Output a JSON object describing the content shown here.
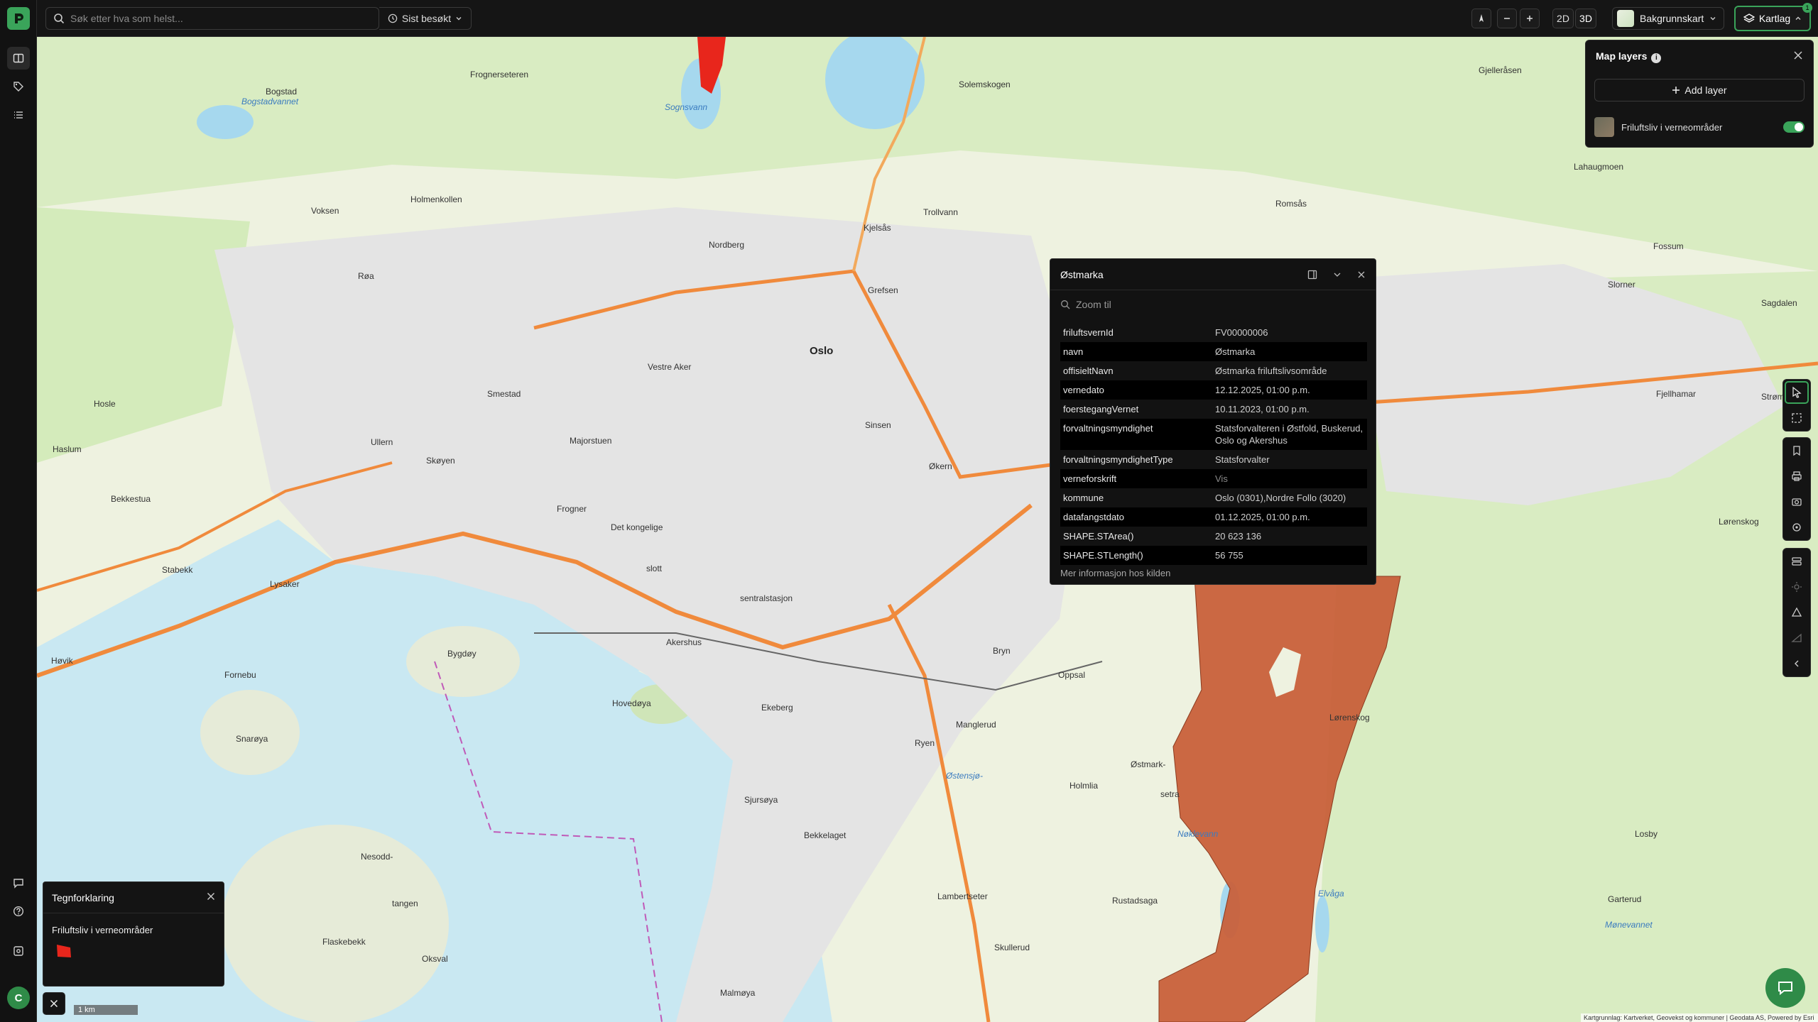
{
  "topbar": {
    "search_placeholder": "Søk etter hva som helst...",
    "recent_label": "Sist besøkt",
    "mode_2d": "2D",
    "mode_3d": "3D",
    "basemap_label": "Bakgrunnskart",
    "layers_label": "Kartlag",
    "layers_count": "1"
  },
  "layers_panel": {
    "title": "Map layers",
    "add_label": "Add layer",
    "layers": [
      {
        "name": "Friluftsliv i verneområder",
        "enabled": true
      }
    ]
  },
  "popup": {
    "title": "Østmarka",
    "zoom_label": "Zoom til",
    "rows": [
      {
        "key": "friluftsvernId",
        "value": "FV00000006"
      },
      {
        "key": "navn",
        "value": "Østmarka"
      },
      {
        "key": "offisieltNavn",
        "value": "Østmarka friluftslivsområde"
      },
      {
        "key": "vernedato",
        "value": "12.12.2025, 01:00 p.m."
      },
      {
        "key": "foerstegangVernet",
        "value": "10.11.2023, 01:00 p.m."
      },
      {
        "key": "forvaltningsmyndighet",
        "value": "Statsforvalteren i Østfold, Buskerud, Oslo og Akershus"
      },
      {
        "key": "forvaltningsmyndighetType",
        "value": "Statsforvalter"
      },
      {
        "key": "verneforskrift",
        "value": "Vis"
      },
      {
        "key": "kommune",
        "value": "Oslo (0301),Nordre Follo (3020)"
      },
      {
        "key": "datafangstdato",
        "value": "01.12.2025, 01:00 p.m."
      },
      {
        "key": "SHAPE.STArea()",
        "value": "20 623 136"
      },
      {
        "key": "SHAPE.STLength()",
        "value": "56 755"
      }
    ],
    "more_label": "Mer informasjon hos kilden"
  },
  "legend": {
    "title": "Tegnforklaring",
    "layer_name": "Friluftsliv i verneområder",
    "swatch_color": "#e8261c"
  },
  "map": {
    "scale_label": "1 km",
    "attribution": "Kartgrunnlag: Kartverket, Geovekst og kommuner | Geodata AS, Powered by Esri",
    "area_color": "#c8603a",
    "places": [
      {
        "text": "Oslo",
        "big": true
      },
      {
        "text": "Vestre Aker"
      },
      {
        "text": "Frogner"
      },
      {
        "text": "Det kongelige"
      },
      {
        "text": "slott"
      },
      {
        "text": "sentralstasjon"
      },
      {
        "text": "Akershus"
      },
      {
        "text": "Ullern"
      },
      {
        "text": "Skøyen"
      },
      {
        "text": "Smestad"
      },
      {
        "text": "Majorstuen"
      },
      {
        "text": "Sinsen"
      },
      {
        "text": "Økern"
      },
      {
        "text": "Bryn"
      },
      {
        "text": "Oppsal"
      },
      {
        "text": "Ryen"
      },
      {
        "text": "Manglerud"
      },
      {
        "text": "Ekeberg"
      },
      {
        "text": "Bekkelaget"
      },
      {
        "text": "Lambertseter"
      },
      {
        "text": "Skullerud"
      },
      {
        "text": "Rustadsaga"
      },
      {
        "text": "Østmark-"
      },
      {
        "text": "setra"
      },
      {
        "text": "Nøklevann",
        "water": true
      },
      {
        "text": "Elvåga",
        "water": true
      },
      {
        "text": "Lørenskog"
      },
      {
        "text": "Holmenkollen"
      },
      {
        "text": "Voksen"
      },
      {
        "text": "Røa"
      },
      {
        "text": "Hosle"
      },
      {
        "text": "Haslum"
      },
      {
        "text": "Bekkestua"
      },
      {
        "text": "Stabekk"
      },
      {
        "text": "Lysaker"
      },
      {
        "text": "Høvik"
      },
      {
        "text": "Fornebu"
      },
      {
        "text": "Snarøya"
      },
      {
        "text": "Bygdøy"
      },
      {
        "text": "Hovedøya"
      },
      {
        "text": "Sjursøya"
      },
      {
        "text": "Nesodd-"
      },
      {
        "text": "tangen"
      },
      {
        "text": "Flaskebekk"
      },
      {
        "text": "Oksval"
      },
      {
        "text": "Malmøya"
      },
      {
        "text": "Sognsvann",
        "water": true
      },
      {
        "text": "Frognerseteren"
      },
      {
        "text": "Solemskogen"
      },
      {
        "text": "Kjelsås"
      },
      {
        "text": "Grefsen"
      },
      {
        "text": "Nordberg"
      },
      {
        "text": "Trollvann"
      },
      {
        "text": "Romsås"
      },
      {
        "text": "Fossum"
      },
      {
        "text": "Slorner"
      },
      {
        "text": "Sagdalen"
      },
      {
        "text": "Fjellhamar"
      },
      {
        "text": "Strømmen"
      },
      {
        "text": "Lørenskog"
      },
      {
        "text": "Lahaugmoen"
      },
      {
        "text": "Bogstad"
      },
      {
        "text": "Bogstadvannet",
        "water": true
      },
      {
        "text": "Østensjø-",
        "water": true
      },
      {
        "text": "Mønevannet",
        "water": true
      },
      {
        "text": "Garterud"
      },
      {
        "text": "Losby"
      },
      {
        "text": "Gjelleråsen"
      },
      {
        "text": "Holmlia"
      }
    ]
  }
}
